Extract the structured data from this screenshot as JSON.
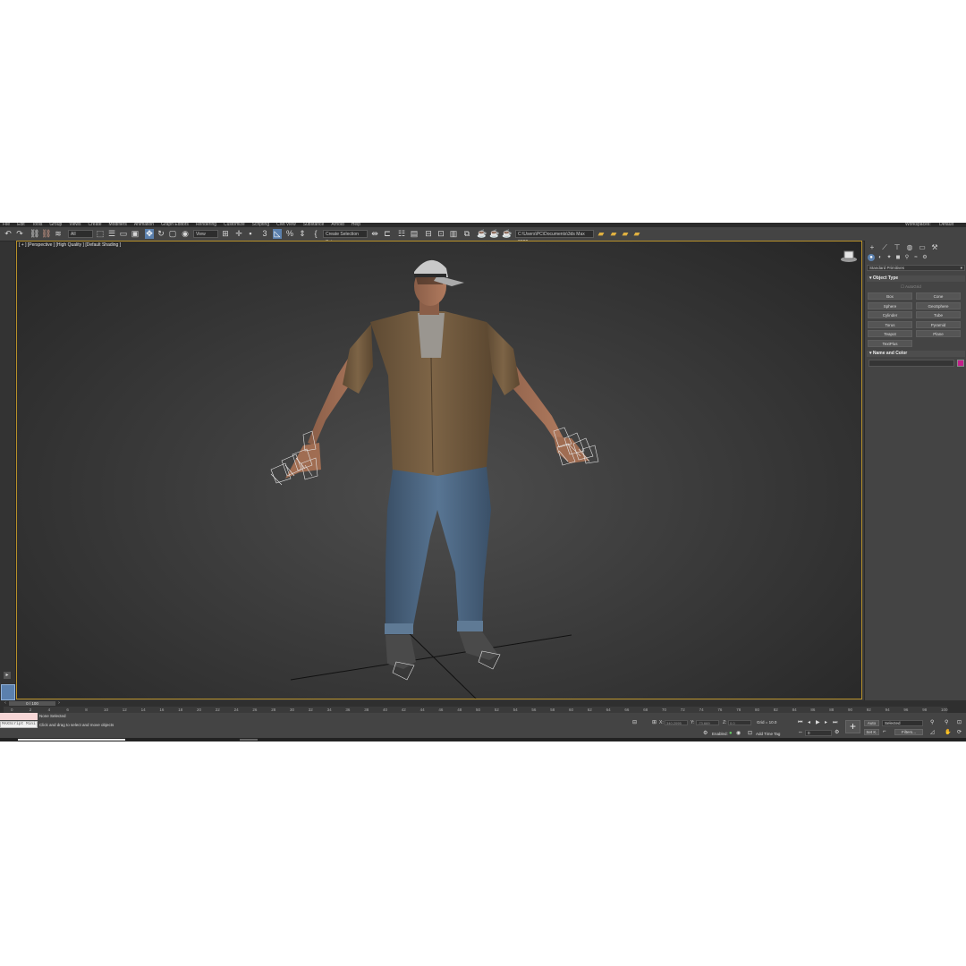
{
  "menu": [
    "File",
    "Edit",
    "Tools",
    "Group",
    "Views",
    "Create",
    "Modifiers",
    "Animation",
    "Graph Editors",
    "Rendering",
    "Customize",
    "Scripting",
    "Civil View",
    "Substance",
    "Arnold",
    "Help"
  ],
  "workspace": {
    "label": "Workspaces:",
    "value": "Default"
  },
  "toolbar": {
    "undo_icon": "↶",
    "redo_icon": "↷",
    "link_icon": "⛓",
    "unlink_icon": "⛓",
    "filter_value": "All",
    "ref_coord_value": "View",
    "snap3_label": "3",
    "percent_label": "%",
    "create_selection_set": "Create Selection Set",
    "project_path": "C:\\Users\\PC\\Documents\\3ds Max 2022"
  },
  "viewport": {
    "label": "[ + ] [Perspective ] [High Quality ] [Default Shading ]",
    "accent": "#b8912a"
  },
  "command_panel": {
    "category_dropdown": "Standard Primitives",
    "object_type_header": "Object Type",
    "autogrid_label": "AutoGrid",
    "objects": [
      "Box",
      "Cone",
      "Sphere",
      "GeoSphere",
      "Cylinder",
      "Tube",
      "Torus",
      "Pyramid",
      "Teapot",
      "Plane",
      "TextPlus"
    ],
    "name_color_header": "Name and Color",
    "color_swatch": "#c41f8a"
  },
  "timeline": {
    "slider_label": "0 / 100",
    "ticks": [
      "0",
      "2",
      "4",
      "6",
      "8",
      "10",
      "12",
      "14",
      "16",
      "18",
      "20",
      "22",
      "24",
      "26",
      "28",
      "30",
      "32",
      "34",
      "36",
      "38",
      "40",
      "42",
      "44",
      "46",
      "48",
      "50",
      "52",
      "54",
      "56",
      "58",
      "60",
      "62",
      "64",
      "66",
      "68",
      "70",
      "72",
      "74",
      "76",
      "78",
      "80",
      "82",
      "84",
      "86",
      "88",
      "90",
      "92",
      "94",
      "96",
      "98",
      "100"
    ]
  },
  "status": {
    "maxscript_label": "MAXScript Mini",
    "selection_text": "None Selected",
    "prompt_text": "Click and drag to select and move objects",
    "x_label": "X:",
    "x_value": "340.2095",
    "y_label": "Y:",
    "y_value": "-73.669",
    "z_label": "Z:",
    "z_value": "0.0",
    "grid_text": "Grid = 10.0",
    "enabled_label": "Enabled:",
    "add_time_tag": "Add Time Tag",
    "auto_label": "Auto",
    "set_key_label": "Set K.",
    "selected_value": "Selected",
    "filters_label": "Filters...",
    "frame_value": "0"
  }
}
